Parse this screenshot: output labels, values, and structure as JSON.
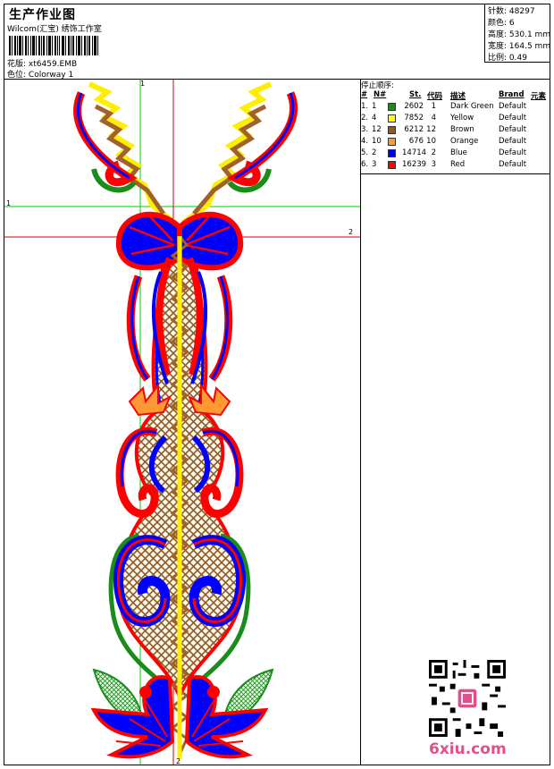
{
  "header": {
    "title": "生产作业图",
    "subtitle": "Wilcom(汇宝) 绣饰工作室",
    "pattern_label": "花版:",
    "pattern_value": "xt6459.EMB",
    "colorway_label": "色位:",
    "colorway_value": "Colorway 1"
  },
  "stats": [
    {
      "label": "针数:",
      "value": "48297"
    },
    {
      "label": "颜色:",
      "value": "6"
    },
    {
      "label": "高度:",
      "value": "530.1 mm"
    },
    {
      "label": "宽度:",
      "value": "164.5 mm"
    },
    {
      "label": "比例:",
      "value": "0.49"
    }
  ],
  "stop_sequence": {
    "title": "停止顺序:",
    "headers": {
      "hash": "#",
      "n": "N#",
      "st": "St.",
      "code": "代码",
      "desc": "描述",
      "brand": "Brand",
      "element": "元素"
    },
    "rows": [
      {
        "idx": "1.",
        "n": "1",
        "color": "#1a8c1a",
        "st": "2602",
        "code": "1",
        "desc": "Dark Green",
        "brand": "Default"
      },
      {
        "idx": "2.",
        "n": "4",
        "color": "#ffff00",
        "st": "7852",
        "code": "4",
        "desc": "Yellow",
        "brand": "Default"
      },
      {
        "idx": "3.",
        "n": "12",
        "color": "#8b5a2b",
        "st": "6212",
        "code": "12",
        "desc": "Brown",
        "brand": "Default"
      },
      {
        "idx": "4.",
        "n": "10",
        "color": "#ff9933",
        "st": "676",
        "code": "10",
        "desc": "Orange",
        "brand": "Default"
      },
      {
        "idx": "5.",
        "n": "2",
        "color": "#0000ff",
        "st": "14714",
        "code": "2",
        "desc": "Blue",
        "brand": "Default"
      },
      {
        "idx": "6.",
        "n": "3",
        "color": "#ff0000",
        "st": "16239",
        "code": "3",
        "desc": "Red",
        "brand": "Default"
      }
    ]
  },
  "guides": {
    "g1_top": "1",
    "g1_left": "1",
    "g2_right": "2",
    "g2_bottom": "2"
  },
  "watermark": "6xiu.com"
}
